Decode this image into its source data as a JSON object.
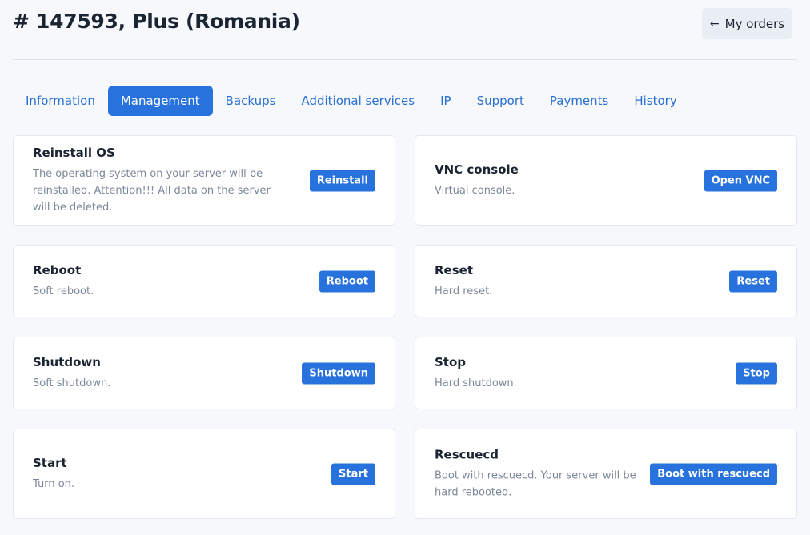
{
  "header": {
    "title": "# 147593, Plus (Romania)",
    "my_orders_label": "My orders",
    "my_orders_icon": "arrow-left-icon"
  },
  "tabs": [
    {
      "label": "Information",
      "active": false
    },
    {
      "label": "Management",
      "active": true
    },
    {
      "label": "Backups",
      "active": false
    },
    {
      "label": "Additional services",
      "active": false
    },
    {
      "label": "IP",
      "active": false
    },
    {
      "label": "Support",
      "active": false
    },
    {
      "label": "Payments",
      "active": false
    },
    {
      "label": "History",
      "active": false
    }
  ],
  "cards": {
    "reinstall": {
      "title": "Reinstall OS",
      "desc": "The operating system on your server will be reinstalled. Attention!!! All data on the server will be deleted.",
      "button": "Reinstall"
    },
    "vnc": {
      "title": "VNC console",
      "desc": "Virtual console.",
      "button": "Open VNC"
    },
    "reboot": {
      "title": "Reboot",
      "desc": "Soft reboot.",
      "button": "Reboot"
    },
    "reset": {
      "title": "Reset",
      "desc": "Hard reset.",
      "button": "Reset"
    },
    "shutdown": {
      "title": "Shutdown",
      "desc": "Soft shutdown.",
      "button": "Shutdown"
    },
    "stop": {
      "title": "Stop",
      "desc": "Hard shutdown.",
      "button": "Stop"
    },
    "start": {
      "title": "Start",
      "desc": "Turn on.",
      "button": "Start"
    },
    "rescue": {
      "title": "Rescuecd",
      "desc": "Boot with rescuecd. Your server will be hard rebooted.",
      "button": "Boot with rescuecd"
    }
  },
  "colors": {
    "accent": "#2872de",
    "background": "#f6f8fb",
    "card": "#ffffff",
    "muted_text": "#7c8898"
  }
}
